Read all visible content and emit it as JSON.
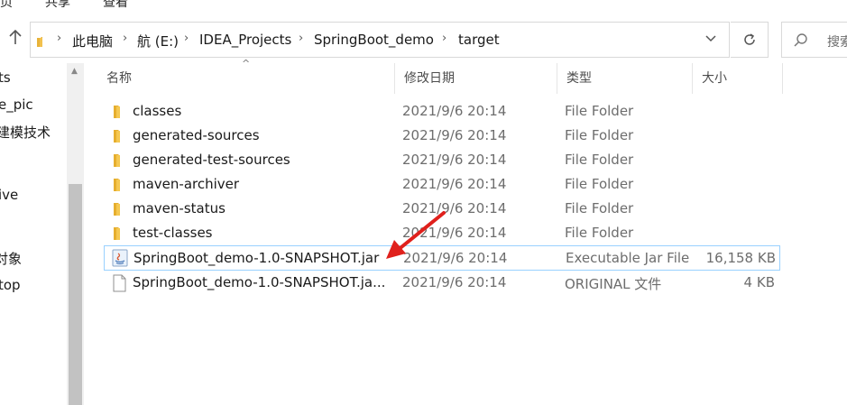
{
  "ribbon": {
    "tabs": [
      "页",
      "共享",
      "查看"
    ]
  },
  "address_bar": {
    "up_icon": "up-arrow-icon",
    "breadcrumbs": [
      "此电脑",
      "航 (E:)",
      "IDEA_Projects",
      "SpringBoot_demo",
      "target"
    ],
    "dropdown_icon": "chevron-down-icon",
    "refresh_icon": "refresh-icon"
  },
  "search": {
    "placeholder": "搜索"
  },
  "nav_pane": {
    "items": [
      "ts",
      "e_pic",
      "建模技术",
      "ive",
      "对象",
      "top"
    ]
  },
  "columns": {
    "name": "名称",
    "date": "修改日期",
    "type": "类型",
    "size": "大小"
  },
  "files": [
    {
      "name": "classes",
      "date": "2021/9/6 20:14",
      "type": "File Folder",
      "size": "",
      "icon": "folder-icon"
    },
    {
      "name": "generated-sources",
      "date": "2021/9/6 20:14",
      "type": "File Folder",
      "size": "",
      "icon": "folder-icon"
    },
    {
      "name": "generated-test-sources",
      "date": "2021/9/6 20:14",
      "type": "File Folder",
      "size": "",
      "icon": "folder-icon"
    },
    {
      "name": "maven-archiver",
      "date": "2021/9/6 20:14",
      "type": "File Folder",
      "size": "",
      "icon": "folder-icon"
    },
    {
      "name": "maven-status",
      "date": "2021/9/6 20:14",
      "type": "File Folder",
      "size": "",
      "icon": "folder-icon"
    },
    {
      "name": "test-classes",
      "date": "2021/9/6 20:14",
      "type": "File Folder",
      "size": "",
      "icon": "folder-icon"
    },
    {
      "name": "SpringBoot_demo-1.0-SNAPSHOT.jar",
      "date": "2021/9/6 20:14",
      "type": "Executable Jar File",
      "size": "16,158 KB",
      "icon": "java-jar-icon",
      "selected": true
    },
    {
      "name": "SpringBoot_demo-1.0-SNAPSHOT.ja...",
      "date": "2021/9/6 20:14",
      "type": "ORIGINAL 文件",
      "size": "4 KB",
      "icon": "blank-file-icon"
    }
  ],
  "annotation": {
    "icon": "red-arrow-icon",
    "color": "#e0201c"
  },
  "colors": {
    "folder": "#f2c14e",
    "selection_border": "#99d1ff",
    "muted_text": "#6d6d6d"
  }
}
